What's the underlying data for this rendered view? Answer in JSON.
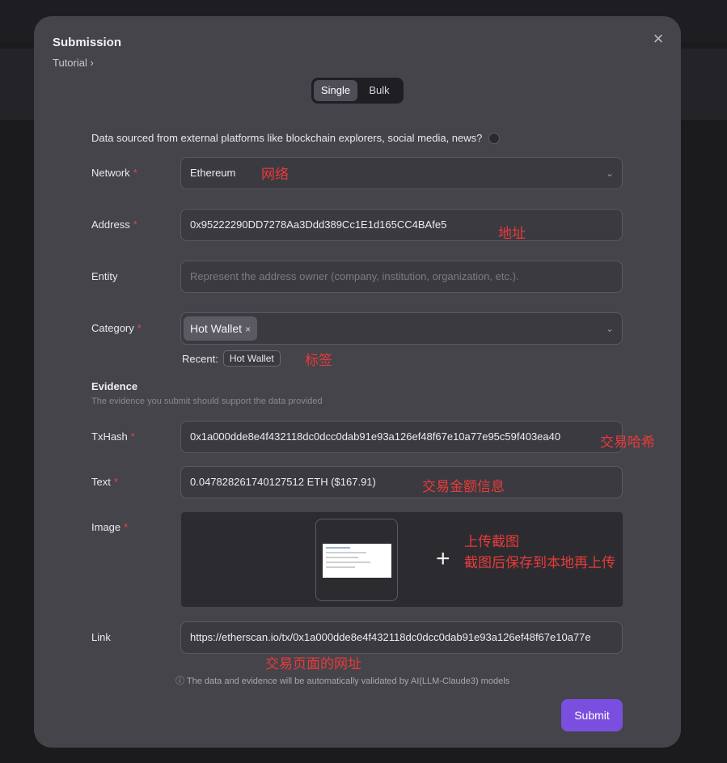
{
  "modal": {
    "title": "Submission",
    "tutorial": "Tutorial",
    "close_icon": "close-icon",
    "mode_tabs": {
      "single": "Single",
      "bulk": "Bulk",
      "active": "Single"
    },
    "external_question": "Data sourced from external platforms like blockchain explorers, social media, news?"
  },
  "form": {
    "network": {
      "label": "Network",
      "value": "Ethereum"
    },
    "address": {
      "label": "Address",
      "value": "0x95222290DD7278Aa3Ddd389Cc1E1d165CC4BAfe5"
    },
    "entity": {
      "label": "Entity",
      "placeholder": "Represent the address owner (company, institution, organization, etc.)."
    },
    "category": {
      "label": "Category",
      "tag": "Hot Wallet",
      "tag_remove": "×",
      "recent_label": "Recent:",
      "recent_chip": "Hot Wallet"
    },
    "evidence": {
      "title": "Evidence",
      "subtitle": "The evidence you submit should support the data provided"
    },
    "txhash": {
      "label": "TxHash",
      "value": "0x1a000dde8e4f432118dc0dcc0dab91e93a126ef48f67e10a77e95c59f403ea40"
    },
    "text": {
      "label": "Text",
      "value": "0.047828261740127512 ETH ($167.91)"
    },
    "image": {
      "label": "Image",
      "add_icon": "plus-icon"
    },
    "link": {
      "label": "Link",
      "value": "https://etherscan.io/tx/0x1a000dde8e4f432118dc0dcc0dab91e93a126ef48f67e10a77e"
    }
  },
  "footer": {
    "note": "The data and evidence will be automatically validated by AI(LLM-Claude3) models",
    "note_icon": "info-icon",
    "submit": "Submit"
  },
  "annotations": {
    "network": "网络",
    "address": "地址",
    "category": "标签",
    "txhash": "交易哈希",
    "text": "交易金额信息",
    "image_line1": "上传截图",
    "image_line2": "截图后保存到本地再上传",
    "link": "交易页面的网址"
  },
  "colors": {
    "modal_bg": "#45444a",
    "accent": "#7a4fe0",
    "annotation": "#e83a3a",
    "required": "#d84a4a"
  }
}
